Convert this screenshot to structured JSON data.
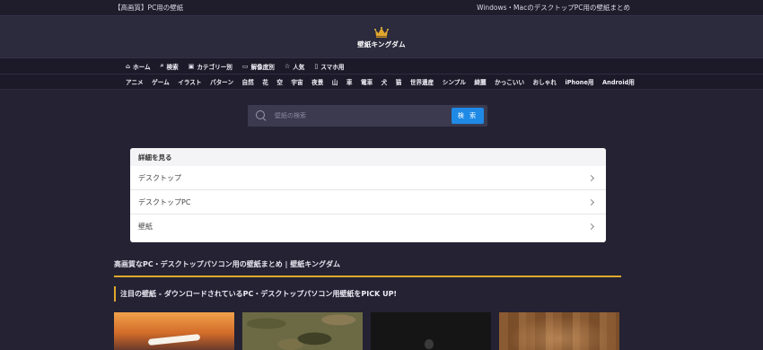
{
  "topbar": {
    "left": "【高画質】PC用の壁紙",
    "right": "Windows・MacのデスクトップPC用の壁紙まとめ"
  },
  "logo": {
    "text": "壁紙キングダム",
    "icon": "crown-icon",
    "accent": "#e0a82e"
  },
  "nav_main": [
    {
      "label": "ホーム",
      "icon": "home-icon",
      "glyph": "⌂"
    },
    {
      "label": "検索",
      "icon": "search-icon",
      "glyph": "⌕"
    },
    {
      "label": "カテゴリー別",
      "icon": "folder-icon",
      "glyph": "▣"
    },
    {
      "label": "解像度別",
      "icon": "monitor-icon",
      "glyph": "▭"
    },
    {
      "label": "人気",
      "icon": "star-icon",
      "glyph": "☆"
    },
    {
      "label": "スマホ用",
      "icon": "phone-icon",
      "glyph": "▯"
    }
  ],
  "nav_tags": [
    "アニメ",
    "ゲーム",
    "イラスト",
    "パターン",
    "自然",
    "花",
    "空",
    "宇宙",
    "夜景",
    "山",
    "車",
    "電車",
    "犬",
    "猫",
    "世界遺産",
    "シンプル",
    "綺麗",
    "かっこいい",
    "おしゃれ",
    "iPhone用",
    "Android用"
  ],
  "search": {
    "placeholder": "壁紙の検索",
    "button_label": "検 索",
    "button_color": "#1f8ae6"
  },
  "card": {
    "header": "詳細を見る",
    "rows": [
      "デスクトップ",
      "デスクトップPC",
      "壁紙"
    ]
  },
  "section_title": "高画質なPC・デスクトップパソコン用の壁紙まとめ | 壁紙キングダム",
  "featured_title": "注目の壁紙 - ダウンロードされているPC・デスクトップパソコン用壁紙をPICK UP!"
}
